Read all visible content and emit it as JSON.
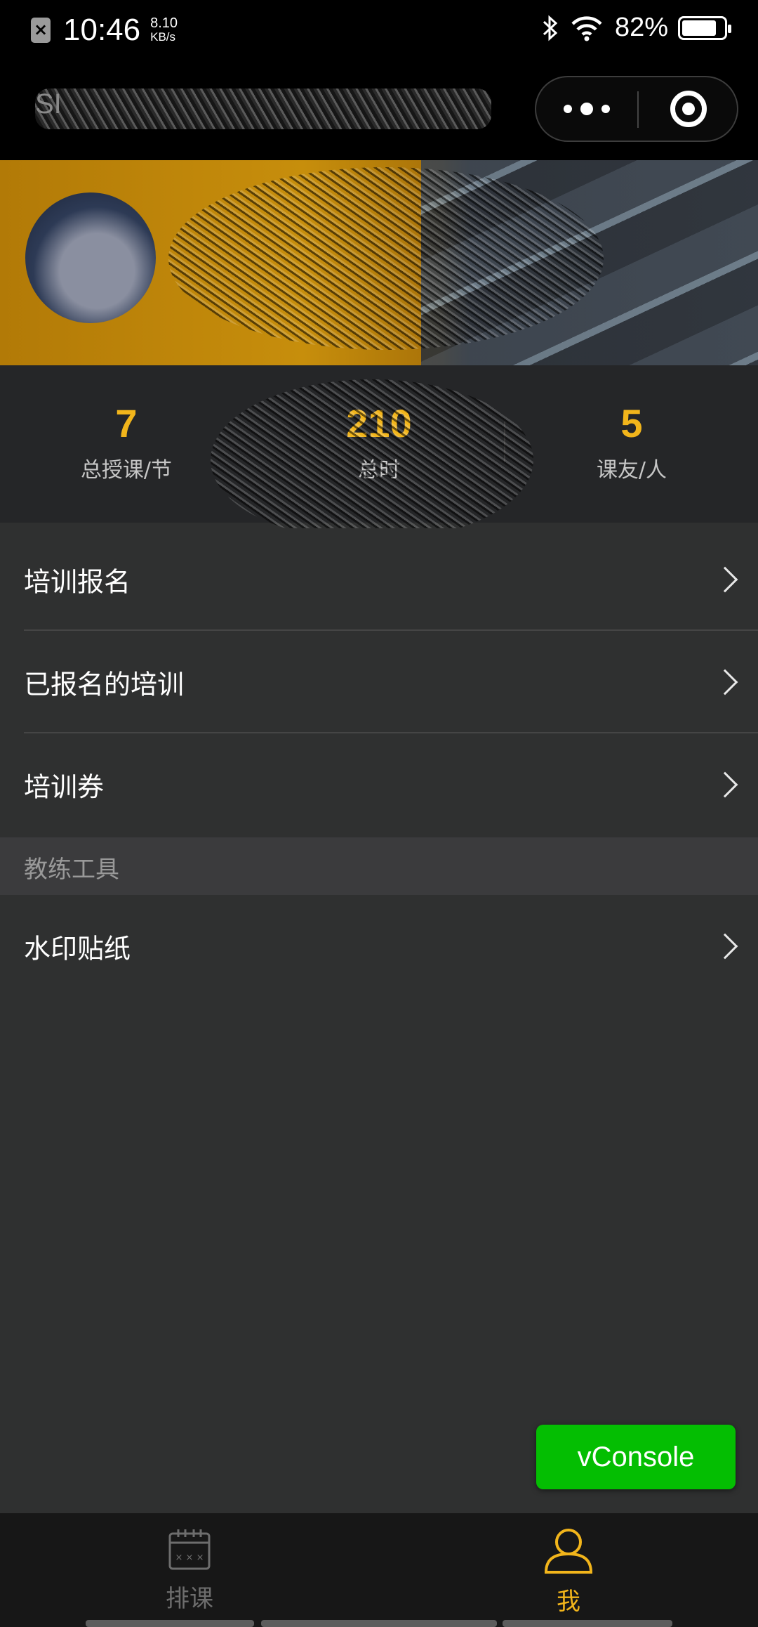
{
  "status_bar": {
    "time": "10:46",
    "net_speed_value": "8.10",
    "net_speed_unit": "KB/s",
    "battery_text": "82%",
    "battery_level": 0.82
  },
  "nav": {
    "title": "SI"
  },
  "stats": [
    {
      "value": "7",
      "label": "总授课/节"
    },
    {
      "value": "210",
      "label": "总时"
    },
    {
      "value": "5",
      "label": "课友/人"
    }
  ],
  "menu": {
    "items": [
      {
        "label": "培训报名"
      },
      {
        "label": "已报名的培训"
      },
      {
        "label": "培训券"
      }
    ],
    "section_title": "教练工具",
    "tool_items": [
      {
        "label": "水印贴纸"
      }
    ]
  },
  "vconsole_label": "vConsole",
  "tabbar": {
    "items": [
      {
        "label": "排课",
        "color": "#6d6d6d"
      },
      {
        "label": "我",
        "color": "#f2b51b"
      }
    ]
  }
}
